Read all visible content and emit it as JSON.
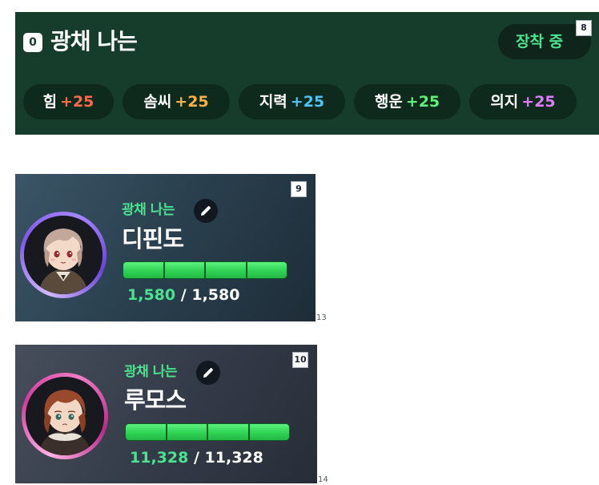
{
  "title_panel": {
    "rank": "0",
    "title": "광채 나는",
    "equip_label": "장착 중",
    "marker": "8",
    "stats": [
      {
        "name": "힘",
        "value": "+25",
        "color": "#ff6b4a"
      },
      {
        "name": "솜씨",
        "value": "+25",
        "color": "#ffb347"
      },
      {
        "name": "지력",
        "value": "+25",
        "color": "#4fc3f7"
      },
      {
        "name": "행운",
        "value": "+25",
        "color": "#5ef07a"
      },
      {
        "name": "의지",
        "value": "+25",
        "color": "#e07cff"
      }
    ]
  },
  "characters": [
    {
      "title": "광채 나는",
      "name": "디핀도",
      "hp_current": "1,580",
      "hp_separator": "/",
      "hp_max": "1,580",
      "hp_fraction": 1.0,
      "ring_color": "#8a63e8",
      "marker": "9",
      "side_label": "13",
      "edit_icon": "pencil-icon"
    },
    {
      "title": "광채 나는",
      "name": "루모스",
      "hp_current": "11,328",
      "hp_separator": "/",
      "hp_max": "11,328",
      "hp_fraction": 1.0,
      "ring_color": "#d13b9c",
      "marker": "10",
      "side_label": "14",
      "edit_icon": "pencil-icon"
    }
  ]
}
